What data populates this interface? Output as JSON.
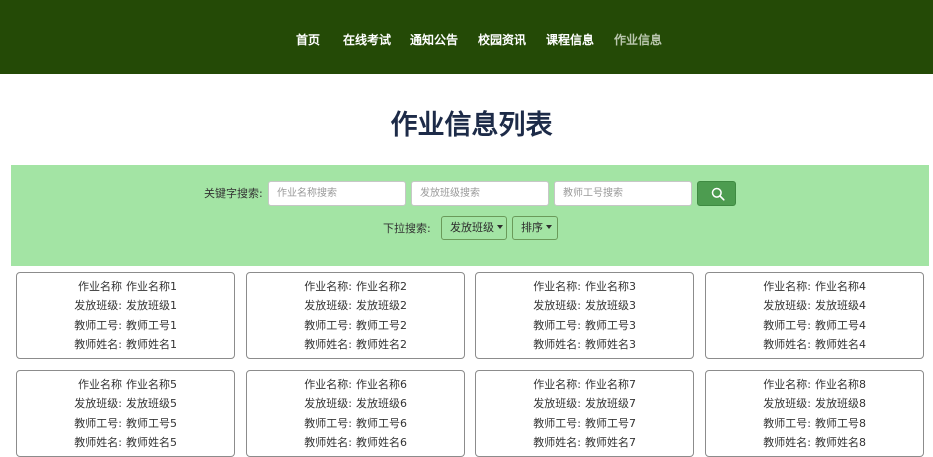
{
  "nav": {
    "items": [
      {
        "label": "首页",
        "active": false
      },
      {
        "label": "在线考试",
        "active": false
      },
      {
        "label": "通知公告",
        "active": false
      },
      {
        "label": "校园资讯",
        "active": false
      },
      {
        "label": "课程信息",
        "active": false
      },
      {
        "label": "作业信息",
        "active": true
      }
    ]
  },
  "page": {
    "title": "作业信息列表"
  },
  "search": {
    "keyword_label": "关键字搜索:",
    "name_placeholder": "作业名称搜索",
    "class_placeholder": "发放班级搜索",
    "teacher_id_placeholder": "教师工号搜索",
    "dropdown_label": "下拉搜索:",
    "class_dropdown": "发放班级",
    "sort_dropdown": "排序"
  },
  "colors": {
    "nav_bg": "#244a06",
    "panel_bg": "#a3e4a4",
    "search_button": "#4d9c50",
    "title": "#1d2b48"
  },
  "cards": [
    {
      "rows": [
        {
          "k": "作业名称",
          "v": "作业名称1"
        },
        {
          "k": "发放班级:",
          "v": "发放班级1"
        },
        {
          "k": "教师工号:",
          "v": "教师工号1"
        },
        {
          "k": "教师姓名:",
          "v": "教师姓名1"
        }
      ]
    },
    {
      "rows": [
        {
          "k": "作业名称:",
          "v": "作业名称2"
        },
        {
          "k": "发放班级:",
          "v": "发放班级2"
        },
        {
          "k": "教师工号:",
          "v": "教师工号2"
        },
        {
          "k": "教师姓名:",
          "v": "教师姓名2"
        }
      ]
    },
    {
      "rows": [
        {
          "k": "作业名称:",
          "v": "作业名称3"
        },
        {
          "k": "发放班级:",
          "v": "发放班级3"
        },
        {
          "k": "教师工号:",
          "v": "教师工号3"
        },
        {
          "k": "教师姓名:",
          "v": "教师姓名3"
        }
      ]
    },
    {
      "rows": [
        {
          "k": "作业名称:",
          "v": "作业名称4"
        },
        {
          "k": "发放班级:",
          "v": "发放班级4"
        },
        {
          "k": "教师工号:",
          "v": "教师工号4"
        },
        {
          "k": "教师姓名:",
          "v": "教师姓名4"
        }
      ]
    },
    {
      "rows": [
        {
          "k": "作业名称",
          "v": "作业名称5"
        },
        {
          "k": "发放班级:",
          "v": "发放班级5"
        },
        {
          "k": "教师工号:",
          "v": "教师工号5"
        },
        {
          "k": "教师姓名:",
          "v": "教师姓名5"
        }
      ]
    },
    {
      "rows": [
        {
          "k": "作业名称:",
          "v": "作业名称6"
        },
        {
          "k": "发放班级:",
          "v": "发放班级6"
        },
        {
          "k": "教师工号:",
          "v": "教师工号6"
        },
        {
          "k": "教师姓名:",
          "v": "教师姓名6"
        }
      ]
    },
    {
      "rows": [
        {
          "k": "作业名称:",
          "v": "作业名称7"
        },
        {
          "k": "发放班级:",
          "v": "发放班级7"
        },
        {
          "k": "教师工号:",
          "v": "教师工号7"
        },
        {
          "k": "教师姓名:",
          "v": "教师姓名7"
        }
      ]
    },
    {
      "rows": [
        {
          "k": "作业名称:",
          "v": "作业名称8"
        },
        {
          "k": "发放班级:",
          "v": "发放班级8"
        },
        {
          "k": "教师工号:",
          "v": "教师工号8"
        },
        {
          "k": "教师姓名:",
          "v": "教师姓名8"
        }
      ]
    }
  ]
}
